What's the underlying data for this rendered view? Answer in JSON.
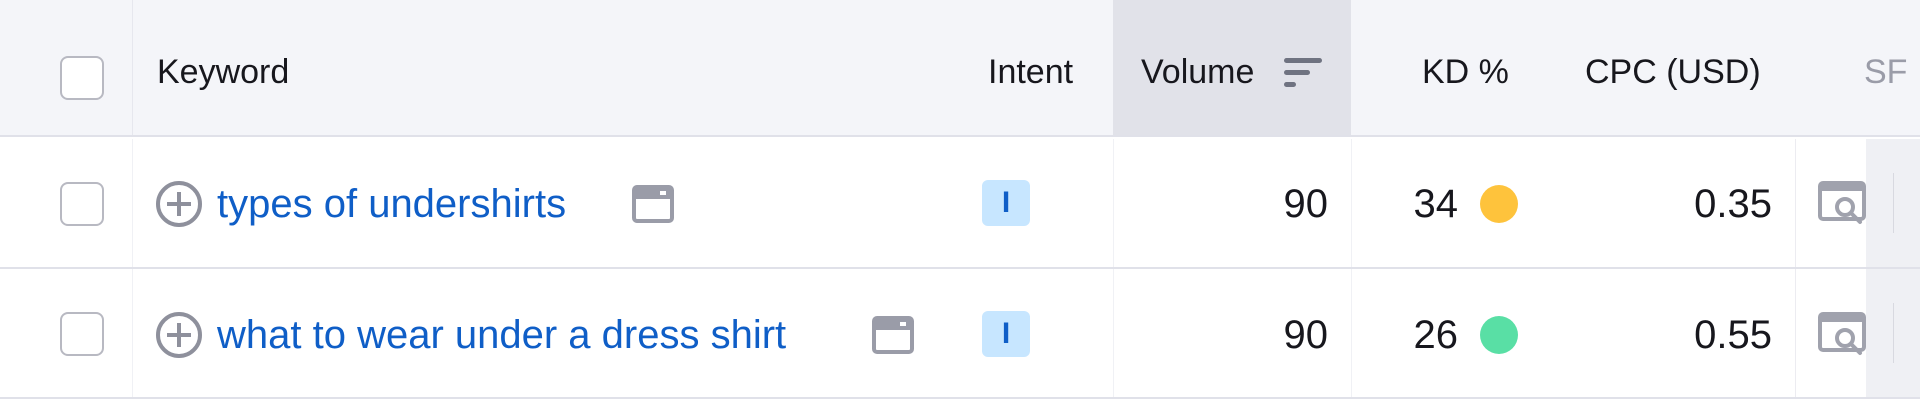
{
  "header": {
    "keyword_label": "Keyword",
    "intent_label": "Intent",
    "volume_label": "Volume",
    "kd_label": "KD %",
    "cpc_label": "CPC (USD)",
    "sf_label": "SF"
  },
  "rows": [
    {
      "keyword": "types of undershirts",
      "intent": "I",
      "volume": "90",
      "kd": "34",
      "kd_color": "#fec33c",
      "cpc": "0.35"
    },
    {
      "keyword": "what to wear under a dress shirt",
      "intent": "I",
      "volume": "90",
      "kd": "26",
      "kd_color": "#59dfa5",
      "cpc": "0.55"
    }
  ],
  "icons": {
    "add": "plus-circle-icon",
    "serp": "serp-window-icon",
    "sort": "sort-descending-icon",
    "sf": "serp-preview-icon"
  },
  "colors": {
    "link": "#0f5ec7",
    "intent_bg": "#c7e6ff",
    "header_bg": "#f4f5f9",
    "sorted_col_bg": "#e1e2e9"
  }
}
